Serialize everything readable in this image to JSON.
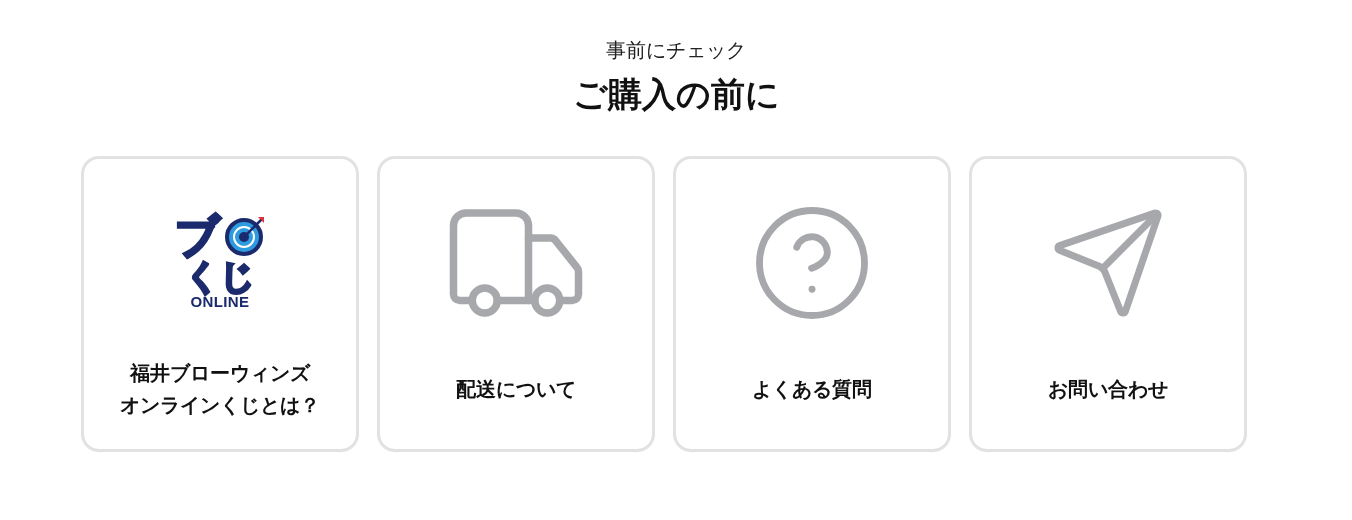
{
  "header": {
    "eyebrow": "事前にチェック",
    "title": "ご購入の前に"
  },
  "cards": [
    {
      "kind": "logo",
      "logo": {
        "top": "ブ",
        "middle": "くじ",
        "bottom": "ONLINE"
      },
      "label_lines": [
        "福井ブローウィンズ",
        "オンラインくじとは？"
      ]
    },
    {
      "kind": "truck",
      "label": "配送について"
    },
    {
      "kind": "question",
      "label": "よくある質問"
    },
    {
      "kind": "plane",
      "label": "お問い合わせ"
    }
  ]
}
